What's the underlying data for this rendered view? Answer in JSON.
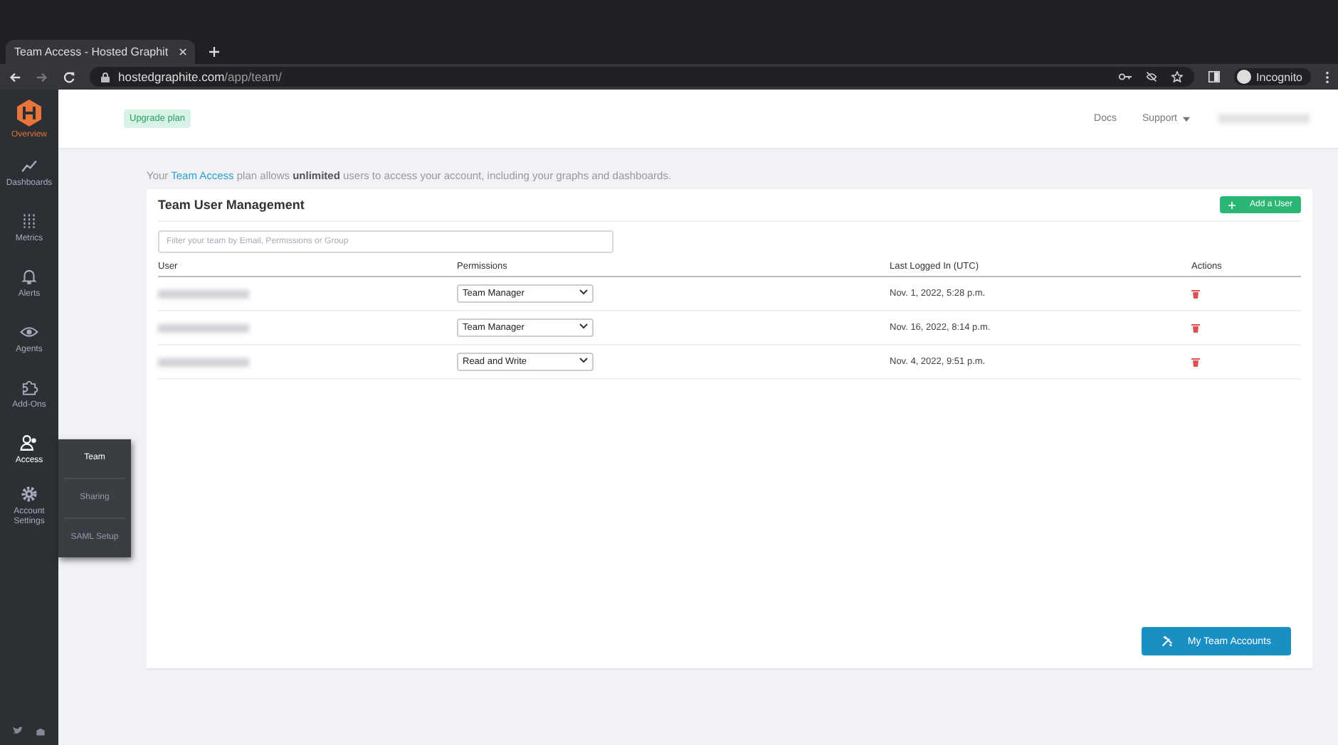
{
  "browser": {
    "tab_title": "Team Access - Hosted Graphit",
    "url_host": "hostedgraphite.com",
    "url_path": "/app/team/",
    "profile": "Incognito"
  },
  "sidebar": {
    "logo_label": "Overview",
    "items": [
      {
        "label": "Dashboards",
        "kind": "chart",
        "selected": false
      },
      {
        "label": "Metrics",
        "kind": "sliders",
        "selected": false
      },
      {
        "label": "Alerts",
        "kind": "bell",
        "selected": false
      },
      {
        "label": "Agents",
        "kind": "eye",
        "selected": false
      },
      {
        "label": "Add-Ons",
        "kind": "puzzle",
        "selected": false
      },
      {
        "label": "Access",
        "kind": "users",
        "selected": true
      },
      {
        "label": "Account Settings",
        "kind": "gear",
        "selected": false
      }
    ],
    "submenu": [
      {
        "label": "Team",
        "selected": true
      },
      {
        "label": "Sharing",
        "selected": false
      },
      {
        "label": "SAML Setup",
        "selected": false
      }
    ]
  },
  "header": {
    "upgrade": "Upgrade plan",
    "links": [
      {
        "label": "Docs",
        "dropdown": false
      },
      {
        "label": "Support",
        "dropdown": true
      }
    ]
  },
  "notice": {
    "before": "Your",
    "link": "Team Access",
    "after": "plan allows **unlimited** users to access your account, including your graphs and dashboards."
  },
  "card": {
    "title": "Team User Management",
    "add_button": "Add a User",
    "filter_placeholder": "Filter your team by Email, Permissions or Group",
    "columns": [
      "User",
      "Permissions",
      "Last Logged In (UTC)",
      "Actions"
    ],
    "rows": [
      {
        "permission": "Team Manager",
        "last_login": "Nov. 1, 2022, 5:28 p.m."
      },
      {
        "permission": "Team Manager",
        "last_login": "Nov. 16, 2022, 8:14 p.m."
      },
      {
        "permission": "Read and Write",
        "last_login": "Nov. 4, 2022, 9:51 p.m."
      }
    ],
    "footer_button": "My Team Accounts"
  }
}
